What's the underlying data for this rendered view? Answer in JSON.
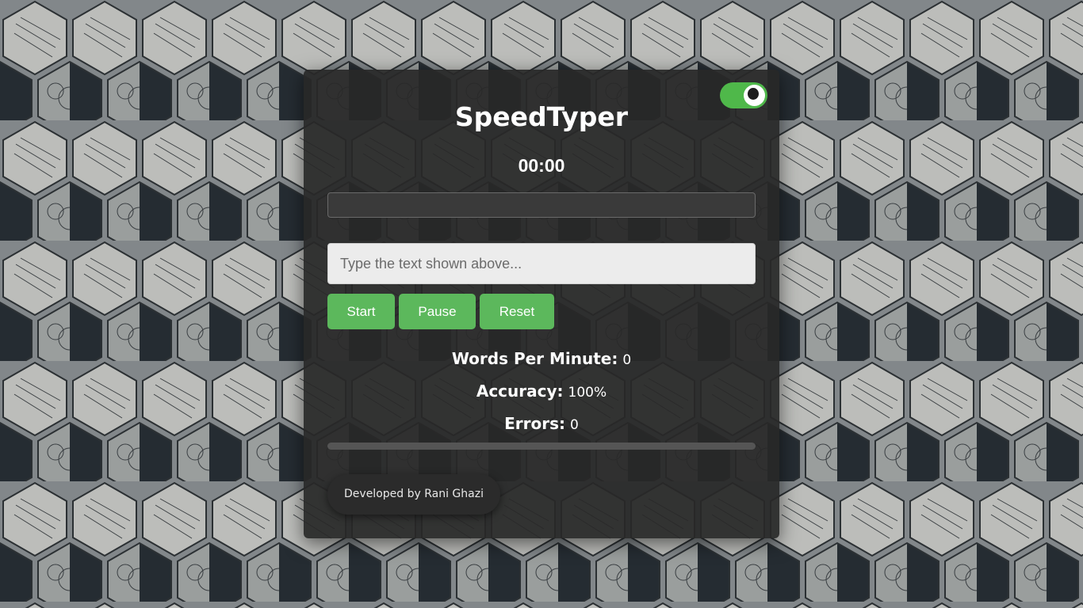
{
  "app": {
    "title": "SpeedTyper",
    "timer": "00:00",
    "theme_toggle_on": true,
    "accent_color": "#5cb85c"
  },
  "text_display": {
    "text": ""
  },
  "input": {
    "placeholder": "Type the text shown above...",
    "value": ""
  },
  "buttons": {
    "start": "Start",
    "pause": "Pause",
    "reset": "Reset"
  },
  "stats": {
    "wpm_label": "Words Per Minute:",
    "wpm_value": "0",
    "accuracy_label": "Accuracy:",
    "accuracy_value": "100%",
    "errors_label": "Errors:",
    "errors_value": "0"
  },
  "progress": {
    "fraction": 0
  },
  "footer": {
    "credit": "Developed by Rani Ghazi"
  },
  "icons": {
    "theme_toggle": "eye-toggle-icon"
  }
}
